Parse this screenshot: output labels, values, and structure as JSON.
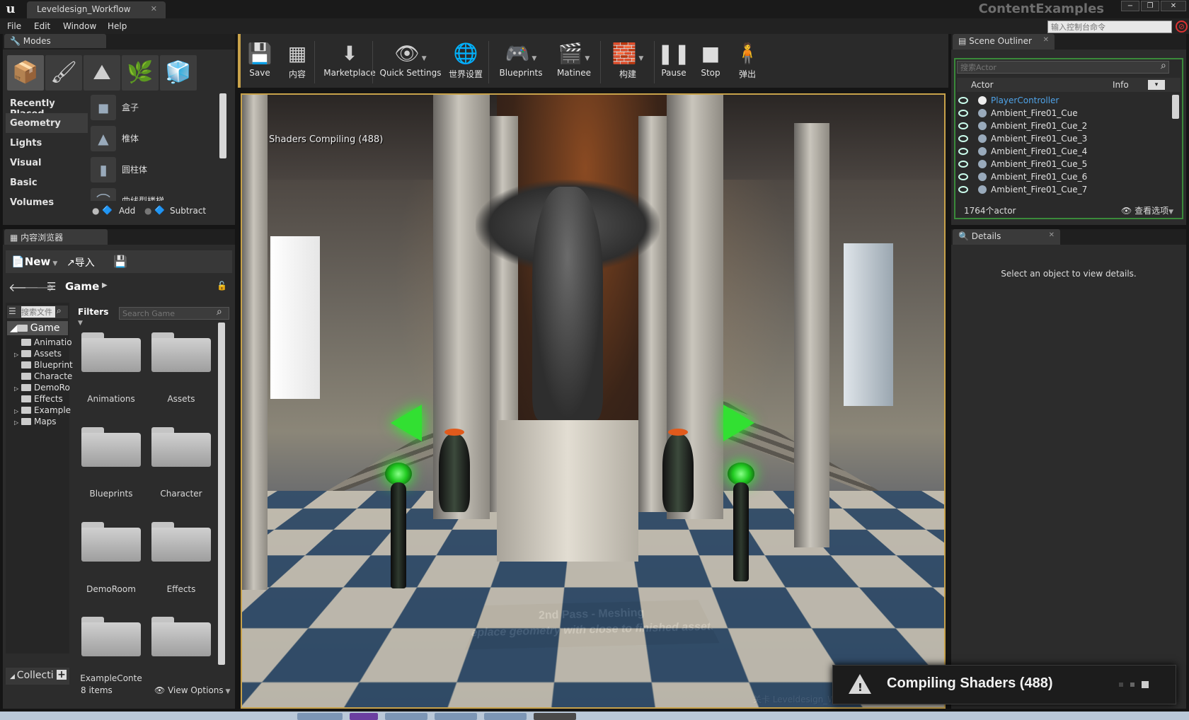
{
  "window": {
    "doc_tab": "Leveldesign_Workflow",
    "project": "ContentExamples",
    "minimize": "−",
    "restore": "❐",
    "close": "✕"
  },
  "menu": [
    "File",
    "Edit",
    "Window",
    "Help"
  ],
  "console": {
    "placeholder": "输入控制台命令"
  },
  "modes": {
    "tab": "Modes",
    "tool_icons": [
      "placement-icon",
      "paint-icon",
      "landscape-icon",
      "foliage-icon",
      "geometry-edit-icon"
    ],
    "categories": [
      "Recently Placed",
      "Geometry",
      "Lights",
      "Visual",
      "Basic",
      "Volumes"
    ],
    "active_category": "Geometry",
    "items": [
      {
        "label": "盒子",
        "icon": "box-icon"
      },
      {
        "label": "椎体",
        "icon": "cone-icon"
      },
      {
        "label": "圆柱体",
        "icon": "cylinder-icon"
      },
      {
        "label": "曲线型楼梯",
        "icon": "curved-stair-icon"
      }
    ],
    "add_label": "Add",
    "subtract_label": "Subtract"
  },
  "content_browser": {
    "tab": "内容浏览器",
    "new_label": "New",
    "import_label": "导入",
    "path_label": "Game",
    "tree_search_placeholder": "搜索文件",
    "filters_label": "Filters",
    "search_placeholder": "Search Game",
    "tree_root": "Game",
    "tree": [
      "Animatio",
      "Assets",
      "Blueprint",
      "Characte",
      "DemoRo",
      "Effects",
      "Example",
      "Maps"
    ],
    "folders": [
      "Animations",
      "Assets",
      "Blueprints",
      "Character",
      "DemoRoom",
      "Effects",
      "ExampleConte",
      "Maps"
    ],
    "collections_label": "Collecti",
    "items_count": "8 items",
    "view_options": "View Options"
  },
  "toolbar": [
    {
      "label": "Save",
      "icon": "save-icon"
    },
    {
      "label": "内容",
      "icon": "content-icon"
    },
    {
      "label": "Marketplace",
      "icon": "marketplace-icon"
    },
    {
      "label": "Quick Settings",
      "icon": "quick-settings-icon"
    },
    {
      "label": "世界设置",
      "icon": "world-settings-icon"
    },
    {
      "label": "Blueprints",
      "icon": "blueprints-icon"
    },
    {
      "label": "Matinee",
      "icon": "matinee-icon"
    },
    {
      "label": "构建",
      "icon": "build-icon"
    },
    {
      "label": "Pause",
      "icon": "pause-icon"
    },
    {
      "label": "Stop",
      "icon": "stop-icon"
    },
    {
      "label": "弹出",
      "icon": "eject-icon"
    }
  ],
  "viewport": {
    "shader_status": "Shaders Compiling (488)",
    "sign_line1": "2nd Pass - Meshing",
    "sign_line2": "replace geometry with close to finished assets",
    "level_label": "关卡  Leveldesign_Workflow (Persistent)"
  },
  "outliner": {
    "tab": "Scene Outliner",
    "search_placeholder": "搜索Actor",
    "col_actor": "Actor",
    "col_info": "Info",
    "rows": [
      "PlayerController",
      "Ambient_Fire01_Cue",
      "Ambient_Fire01_Cue_2",
      "Ambient_Fire01_Cue_3",
      "Ambient_Fire01_Cue_4",
      "Ambient_Fire01_Cue_5",
      "Ambient_Fire01_Cue_6",
      "Ambient_Fire01_Cue_7"
    ],
    "count": "1764个actor",
    "view_options": "查看选项",
    "highlight_color": "#4fa3e8"
  },
  "details": {
    "tab": "Details",
    "empty_message": "Select an object to view details."
  },
  "notification": {
    "text": "Compiling Shaders (488)"
  },
  "colors": {
    "accent": "#c8a24a",
    "outliner_border": "#3a8a3a",
    "selection_text": "#4fa3e8"
  }
}
